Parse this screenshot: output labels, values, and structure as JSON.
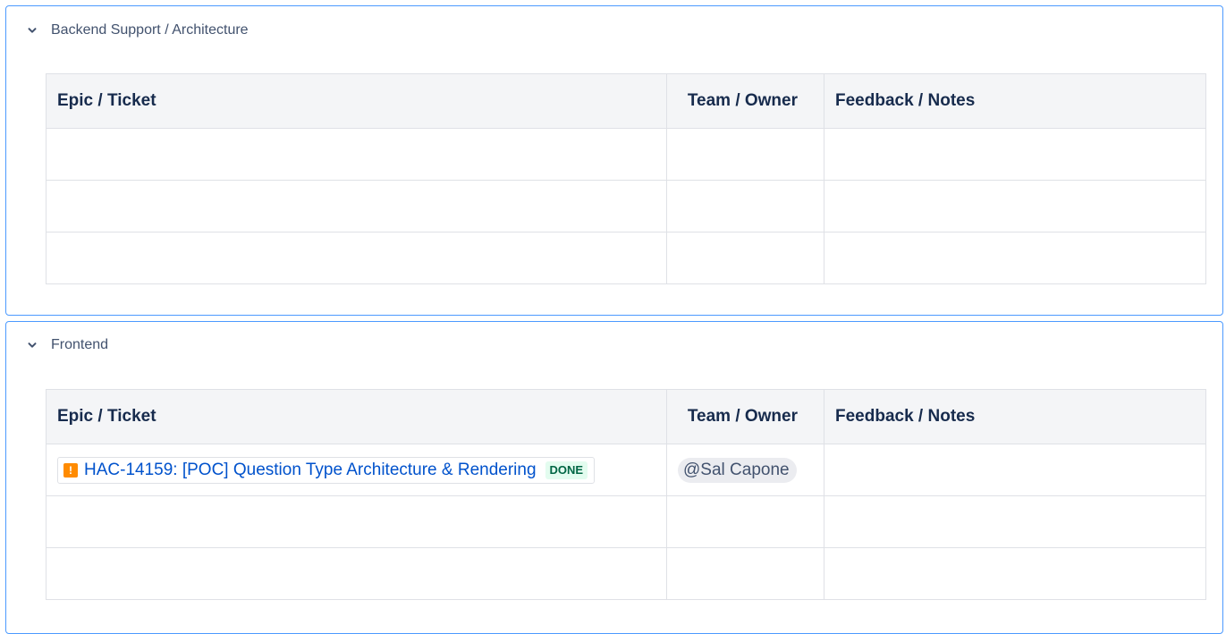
{
  "sections": [
    {
      "title": "Backend Support / Architecture",
      "headers": {
        "ticket": "Epic / Ticket",
        "team": "Team / Owner",
        "notes": "Feedback / Notes"
      }
    },
    {
      "title": "Frontend",
      "headers": {
        "ticket": "Epic / Ticket",
        "team": "Team / Owner",
        "notes": "Feedback / Notes"
      },
      "rows": [
        {
          "ticket_icon": "!",
          "ticket_text": "HAC-14159: [POC] Question Type Architecture & Rendering",
          "status": "DONE",
          "owner": "@Sal Capone"
        }
      ]
    }
  ],
  "colors": {
    "border_accent": "#4c9aff",
    "link": "#0052cc",
    "done_bg": "#e3fcef",
    "done_text": "#006644",
    "priority_icon": "#ff8b00"
  },
  "icons": {
    "expand": "chevron-down-icon",
    "priority": "priority-icon"
  }
}
